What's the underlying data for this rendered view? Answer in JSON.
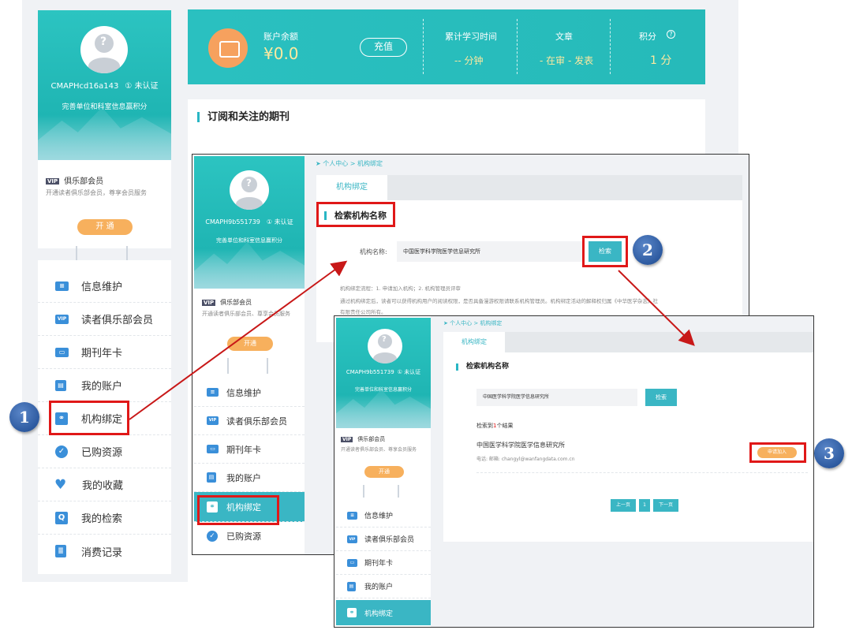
{
  "main": {
    "username": "CMAPHcd16a143",
    "unverified": "① 未认证",
    "complete_hint": "完善单位和科室信息赢积分",
    "vip": {
      "tag": "VIP",
      "title": "俱乐部会员",
      "desc": "开通读者俱乐部会员，尊享会员服务",
      "button": "开 通"
    },
    "menu": [
      "信息维护",
      "读者俱乐部会员",
      "期刊年卡",
      "我的账户",
      "机构绑定",
      "已购资源",
      "我的收藏",
      "我的检索",
      "消费记录"
    ],
    "stats": {
      "balance_label": "账户余额",
      "balance_value": "¥0.0",
      "recharge": "充值",
      "study_label": "累计学习时间",
      "study_value": "-- 分钟",
      "article_label": "文章",
      "article_value": "- 在审 - 发表",
      "points_label": "积分",
      "points_help": "?",
      "points_value": "1 分"
    },
    "journal_section_title": "订阅和关注的期刊"
  },
  "shot2": {
    "username": "CMAPH9b551739",
    "unverified": "① 未认证",
    "complete_hint": "完善单位和科室信息赢积分",
    "vip": {
      "tag": "VIP",
      "title": "俱乐部会员",
      "desc": "开通读者俱乐部会员、尊享会员服务",
      "button": "开通"
    },
    "menu": [
      "信息维护",
      "读者俱乐部会员",
      "期刊年卡",
      "我的账户",
      "机构绑定",
      "已购资源"
    ],
    "breadcrumb": "个人中心 > 机构绑定",
    "tab": "机构绑定",
    "section_title": "检索机构名称",
    "field_label": "机构名称:",
    "field_value": "中国医学科学院医学信息研究所",
    "search_button": "检索",
    "hint1": "机构绑定流程：1. 申请加入机构；2. 机构管理员评审",
    "hint2": "通过机构绑定后，读者可以获得机构用户的阅读权限，是否具备漫游权限请联系机构管理员。机构绑定活动的解释权归属《中华医学杂志》社",
    "hint3": "有限责任公司所有。"
  },
  "shot3": {
    "username": "CMAPH9b551739",
    "unverified": "① 未认证",
    "complete_hint": "完善单位和科室信息赢积分",
    "vip": {
      "tag": "VIP",
      "title": "俱乐部会员",
      "desc": "开通读者俱乐部会员、尊享会员服务",
      "button": "开通"
    },
    "menu": [
      "信息维护",
      "读者俱乐部会员",
      "期刊年卡",
      "我的账户",
      "机构绑定"
    ],
    "breadcrumb": "个人中心 > 机构绑定",
    "tab": "机构绑定",
    "section_title": "检索机构名称",
    "field_value": "中国医学科学院医学信息研究所",
    "search_button": "检索",
    "result_prefix": "检索到",
    "result_count": "1",
    "result_suffix": "个结果",
    "result_name": "中国医学科学院医学信息研究所",
    "result_contact": "电话:  邮箱:  changyl@wanfangdata.com.cn",
    "apply_button": "申请加入",
    "pager": [
      "上一页",
      "1",
      "下一页"
    ]
  },
  "steps": [
    "1",
    "2",
    "3"
  ],
  "colors": {
    "teal": "#2ac0c0",
    "orange": "#f6a15e",
    "highlight": "#e01818",
    "step_blue": "#2d5aa0"
  }
}
